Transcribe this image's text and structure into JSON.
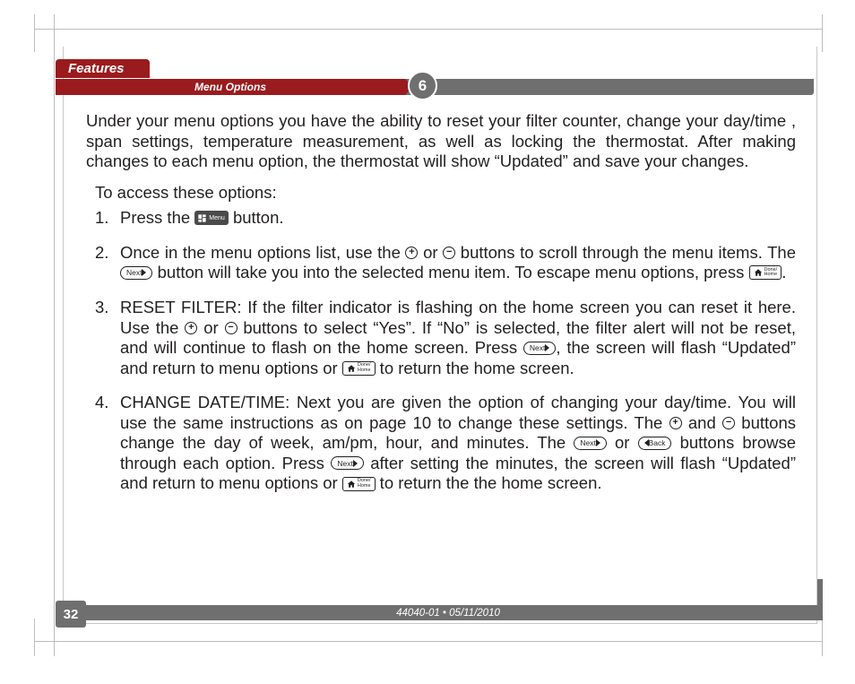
{
  "header": {
    "features_tab": "Features",
    "subsection": "Menu Options",
    "section_number": "6"
  },
  "intro": "Under your menu options you have the ability to reset your filter counter, change your day/time , span settings, temperature measurement, as well as locking the thermostat. After making changes to each menu option, the thermostat will show “Updated” and save your changes.",
  "access_line": "To access these options:",
  "icons": {
    "menu": "Menu",
    "plus": "+",
    "minus": "−",
    "next": "Next",
    "back": "Back",
    "done_home": "Done/\nHome"
  },
  "steps": {
    "s1_a": "Press the ",
    "s1_b": " button.",
    "s2_a": "Once in the menu options list, use the ",
    "s2_b": " or ",
    "s2_c": " buttons to scroll through the menu items. The ",
    "s2_d": " button will take you into the selected menu item. To escape menu options, press ",
    "s2_e": ".",
    "s3_a": "RESET FILTER: If the filter indicator is flashing on the home screen you can reset it here. Use the ",
    "s3_b": " or ",
    "s3_c": " buttons to select “Yes”. If “No” is selected, the filter alert will not be reset, and will continue to flash on the home screen. Press ",
    "s3_d": ", the screen will flash “Updated” and return to menu options or ",
    "s3_e": " to return the home screen.",
    "s4_a": "CHANGE DATE/TIME: Next you are given the option of changing your day/time. You will use the same instructions as on page 10 to change these settings. The ",
    "s4_b": " and ",
    "s4_c": " buttons change the day of week, am/pm, hour, and minutes. The ",
    "s4_d": " or ",
    "s4_e": " buttons browse through each option. Press ",
    "s4_f": " after setting the minutes, the screen will flash “Updated” and return to menu options or ",
    "s4_g": " to return the the home screen."
  },
  "footer": {
    "page_number": "32",
    "doc_id": "44040-01 • 05/11/2010"
  }
}
